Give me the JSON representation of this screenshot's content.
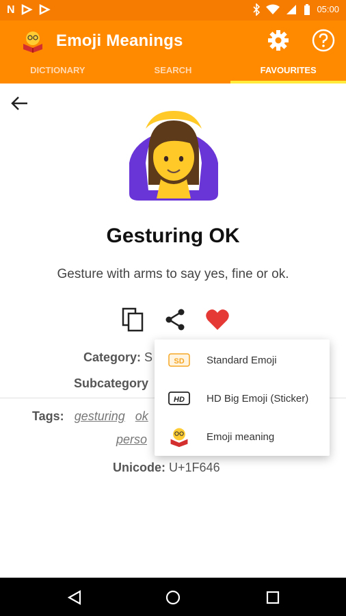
{
  "status_bar": {
    "left_icons": [
      "N",
      "app-icon",
      "app-icon"
    ],
    "time": "05:00"
  },
  "app": {
    "title": "Emoji Meanings",
    "accent": "#ff8a00",
    "status_bg": "#f57c00",
    "tab_indicator": "#ffeb3b"
  },
  "tabs": [
    {
      "label": "DICTIONARY",
      "active": false
    },
    {
      "label": "SEARCH",
      "active": false
    },
    {
      "label": "FAVOURITES",
      "active": true
    }
  ],
  "emoji": {
    "name": "Gesturing OK",
    "description": "Gesture with arms to say yes, fine or ok.",
    "category_label": "Category:",
    "category_value": "S",
    "subcategory_label": "Subcategory",
    "tags_label": "Tags:",
    "tags": [
      "gesturing",
      "ok",
      "perso"
    ],
    "unicode_label": "Unicode:",
    "unicode_value": "U+1F646"
  },
  "popup_menu": {
    "items": [
      {
        "label": "Standard Emoji",
        "icon": "sd-badge-icon"
      },
      {
        "label": "HD Big Emoji (Sticker)",
        "icon": "hd-badge-icon"
      },
      {
        "label": "Emoji meaning",
        "icon": "reading-emoji-icon"
      }
    ],
    "sd_badge": "SD",
    "hd_badge": "HD"
  }
}
